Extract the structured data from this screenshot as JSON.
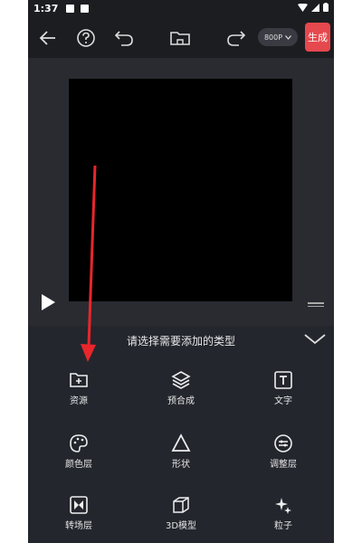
{
  "status_bar": {
    "time": "1:37"
  },
  "toolbar": {
    "resolution": "800P",
    "generate_label": "生成"
  },
  "panel": {
    "title": "请选择需要添加的类型",
    "items": [
      {
        "label": "资源",
        "icon": "folder-add-icon"
      },
      {
        "label": "预合成",
        "icon": "layers-icon"
      },
      {
        "label": "文字",
        "icon": "text-icon"
      },
      {
        "label": "颜色层",
        "icon": "palette-icon"
      },
      {
        "label": "形状",
        "icon": "triangle-icon"
      },
      {
        "label": "调整层",
        "icon": "adjust-icon"
      },
      {
        "label": "转场层",
        "icon": "transition-icon"
      },
      {
        "label": "3D模型",
        "icon": "cube-icon"
      },
      {
        "label": "粒子",
        "icon": "sparkle-icon"
      }
    ]
  },
  "colors": {
    "accent": "#e5484d",
    "annotation_arrow": "#e8262b",
    "panel_bg": "#24262d"
  }
}
